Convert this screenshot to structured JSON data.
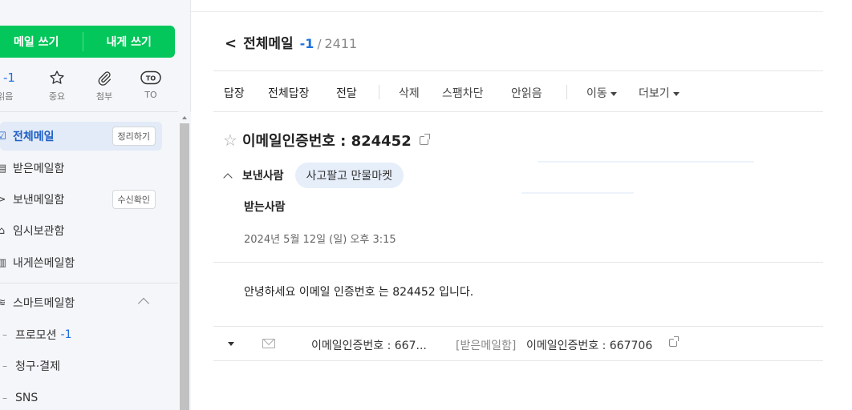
{
  "sidebar": {
    "compose_label": "메일 쓰기",
    "self_compose_label": "내게 쓰기",
    "quick": [
      {
        "icon_text": "-1",
        "label": "안읽음",
        "icon": "unread-count"
      },
      {
        "icon_text": "☆",
        "label": "중요",
        "icon": "star-icon"
      },
      {
        "icon_text": "⌀",
        "label": "첨부",
        "icon": "paperclip-icon"
      },
      {
        "icon_text": "TO",
        "label": "TO",
        "icon": "to-icon"
      }
    ],
    "folders": [
      {
        "icon_text": "☑",
        "label": "전체메일",
        "tag": "정리하기",
        "icon": "all-mail-icon"
      },
      {
        "icon_text": "▤",
        "label": "받은메일함",
        "icon": "inbox-icon"
      },
      {
        "icon_text": ">",
        "label": "보낸메일함",
        "tag": "수신확인",
        "icon": "sent-icon"
      },
      {
        "icon_text": "⌂",
        "label": "임시보관함",
        "icon": "drafts-icon"
      },
      {
        "icon_text": "▥",
        "label": "내게쓴메일함",
        "icon": "self-mail-icon"
      }
    ],
    "smart": {
      "icon_text": "≋",
      "label": "스마트메일함",
      "items": [
        {
          "icon_text": "–",
          "label": "프로모션",
          "count": "-1"
        },
        {
          "icon_text": "–",
          "label": "청구·결제"
        },
        {
          "icon_text": "–",
          "label": "SNS"
        }
      ]
    }
  },
  "header": {
    "back_glyph": "<",
    "title": "전체메일",
    "unread": "-1",
    "slash": "/",
    "total": "2411"
  },
  "toolbar": {
    "reply": "답장",
    "reply_all": "전체답장",
    "forward": "전달",
    "delete": "삭제",
    "spam": "스팸차단",
    "mark_unread": "안읽음",
    "move": "이동",
    "more": "더보기"
  },
  "mail": {
    "star_glyph": "☆",
    "subject": "이메일인증번호 : 824452",
    "from_label": "보낸사람",
    "sender": "사고팔고 만물마켓",
    "to_label": "받는사람",
    "date": "2024년 5월 12일 (일) 오후 3:15",
    "body": "안녕하세요 이메일 인증번호 는 824452 입니다."
  },
  "thread": {
    "subject_short": "이메일인증번호 : 667...",
    "folder": "[받은메일함]",
    "subject_full": "이메일인증번호 : 667706"
  },
  "colors": {
    "brand_green": "#03c75a",
    "accent_blue": "#1e6fe0",
    "chip_bg": "#e6eefa"
  }
}
